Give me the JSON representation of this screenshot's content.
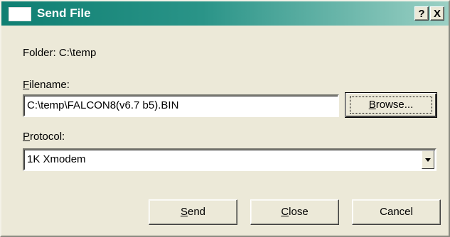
{
  "window": {
    "title": "Send File",
    "help_label": "?",
    "close_label": "X"
  },
  "folder": {
    "label": "Folder:",
    "value": "C:\\temp"
  },
  "filename": {
    "label_first": "F",
    "label_rest": "ilename:",
    "value": "C:\\temp\\FALCON8(v6.7 b5).BIN"
  },
  "browse": {
    "label_first": "B",
    "label_rest": "rowse..."
  },
  "protocol": {
    "label_first": "P",
    "label_rest": "rotocol:",
    "selected": "1K Xmodem"
  },
  "buttons": {
    "send_first": "S",
    "send_rest": "end",
    "close_first": "C",
    "close_rest": "lose",
    "cancel": "Cancel"
  },
  "colors": {
    "titlebar_start": "#0f7f72",
    "titlebar_end": "#9bd0c4",
    "dialog_bg": "#ece9d8"
  }
}
